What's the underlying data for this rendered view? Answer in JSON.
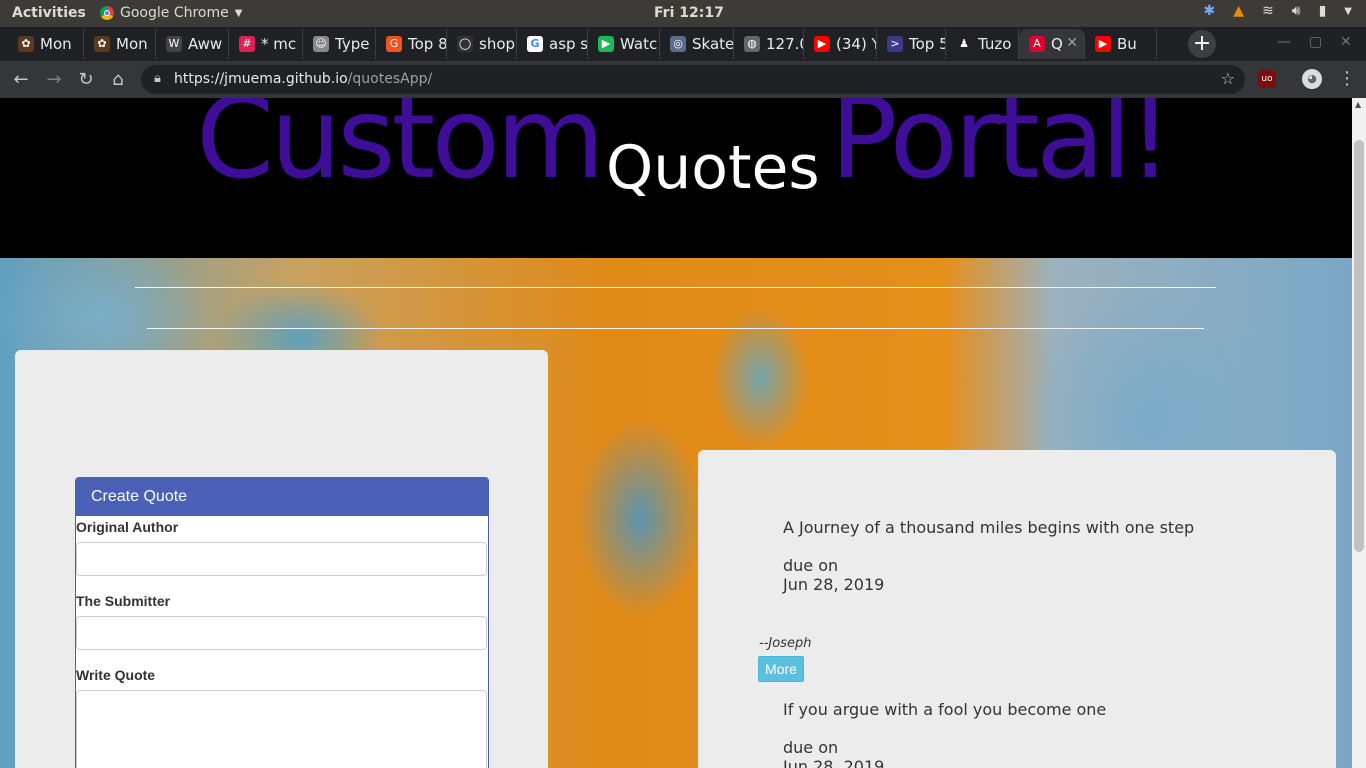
{
  "system_bar": {
    "activities": "Activities",
    "app_name": "Google Chrome",
    "clock": "Fri 12:17"
  },
  "tabs": [
    {
      "label": "Mon",
      "favicon": "monkey-icon",
      "color": "#5b3a1e"
    },
    {
      "label": "Mon",
      "favicon": "monkey-icon",
      "color": "#5b3a1e"
    },
    {
      "label": "Aww",
      "favicon": "awwwards-icon",
      "color": "#444"
    },
    {
      "label": "* mc",
      "favicon": "slack-icon",
      "color": "#e01e5a"
    },
    {
      "label": "Type",
      "favicon": "typeform-icon",
      "color": "#888"
    },
    {
      "label": "Top 8",
      "favicon": "orange-circle-icon",
      "color": "#f4511e"
    },
    {
      "label": "shop",
      "favicon": "github-icon",
      "color": "#333"
    },
    {
      "label": "asp s",
      "favicon": "google-icon",
      "color": "#fff"
    },
    {
      "label": "Watc",
      "favicon": "play-icon",
      "color": "#1db954"
    },
    {
      "label": "Skate",
      "favicon": "skate-icon",
      "color": "#5a6b8c"
    },
    {
      "label": "127.0",
      "favicon": "globe-icon",
      "color": "#666"
    },
    {
      "label": "(34) Y",
      "favicon": "youtube-icon",
      "color": "#ff0000"
    },
    {
      "label": "Top 5",
      "favicon": "terminal-icon",
      "color": "#3b3b8c"
    },
    {
      "label": "Tuzo",
      "favicon": "person-icon",
      "color": "#222"
    },
    {
      "label": "Q",
      "favicon": "angular-icon",
      "color": "#dd0031"
    },
    {
      "label": "Bu",
      "favicon": "youtube-icon",
      "color": "#ff0000"
    }
  ],
  "new_tab": "+",
  "address": {
    "host": "https://jmuema.github.io",
    "path": "/quotesApp/"
  },
  "header": {
    "word1": "Custom",
    "word2": "Quotes",
    "word3": "Portal!",
    "accent": "#3e0e98"
  },
  "form": {
    "title": "Create Quote",
    "author_label": "Original Author",
    "author_value": "",
    "submitter_label": "The Submitter",
    "submitter_value": "",
    "quote_label": "Write Quote",
    "quote_value": ""
  },
  "quotes": [
    {
      "text": "A Journey of a thousand miles begins with one step",
      "due_label": "due on",
      "date": "Jun 28, 2019",
      "author": "--Joseph",
      "button": "More"
    },
    {
      "text": "If you argue with a fool you become one",
      "due_label": "due on",
      "date": "Jun 28, 2019"
    }
  ]
}
